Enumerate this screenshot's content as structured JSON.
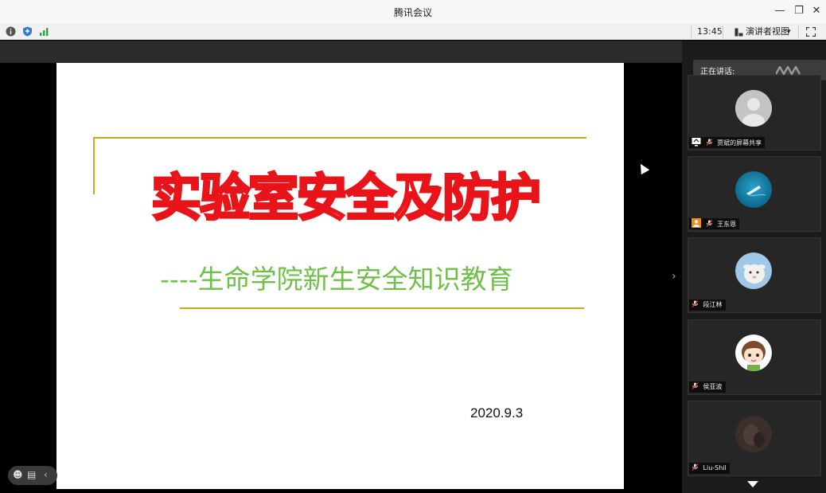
{
  "window": {
    "title": "腾讯会议",
    "controls": {
      "minimize": "—",
      "restore": "❐",
      "close": "✕"
    }
  },
  "toolbar": {
    "time": "13:45",
    "view_mode": "演讲者视图",
    "view_mode_caret": "▾"
  },
  "slide": {
    "title": "实验室安全及防护",
    "subtitle": "----生命学院新生安全知识教育",
    "date": "2020.9.3",
    "title_color": "#e8141a",
    "subtitle_color": "#6fbf4a",
    "rule_color": "#c9a520"
  },
  "sidebar": {
    "speaking_label": "正在讲话:",
    "collapse_chevron": "›",
    "participants": [
      {
        "name": "贾斌的屏幕共享",
        "avatar": "default-avatar-icon",
        "badge": "screen-share-icon"
      },
      {
        "name": "王东恩",
        "avatar": "ocean-photo-avatar",
        "badge": "host-icon"
      },
      {
        "name": "段江林",
        "avatar": "lamb-photo-avatar",
        "badge": ""
      },
      {
        "name": "侯亚波",
        "avatar": "cartoon-boy-avatar",
        "badge": ""
      },
      {
        "name": "Liu-Shil",
        "avatar": "dark-photo-avatar",
        "badge": ""
      }
    ]
  },
  "bottom_controls": {
    "emoji": "☻",
    "chat": "▤",
    "collapse": "‹"
  }
}
